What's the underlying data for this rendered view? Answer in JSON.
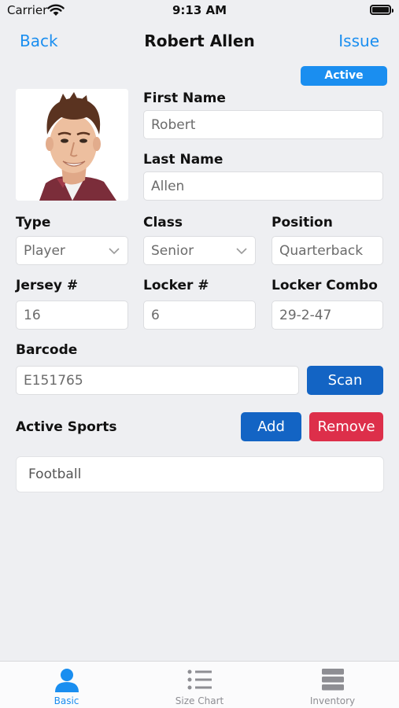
{
  "status_bar": {
    "carrier": "Carrier",
    "time": "9:13 AM"
  },
  "nav": {
    "back_label": "Back",
    "title": "Robert Allen",
    "issue_label": "Issue"
  },
  "status_badge": "Active",
  "form": {
    "first_name_label": "First Name",
    "first_name_value": "Robert",
    "last_name_label": "Last Name",
    "last_name_value": "Allen",
    "type_label": "Type",
    "type_value": "Player",
    "class_label": "Class",
    "class_value": "Senior",
    "position_label": "Position",
    "position_value": "Quarterback",
    "jersey_label": "Jersey #",
    "jersey_value": "16",
    "locker_label": "Locker #",
    "locker_value": "6",
    "combo_label": "Locker Combo",
    "combo_value": "29-2-47",
    "barcode_label": "Barcode",
    "barcode_value": "E151765",
    "scan_label": "Scan"
  },
  "sports": {
    "label": "Active Sports",
    "add_label": "Add",
    "remove_label": "Remove",
    "items": [
      "Football"
    ]
  },
  "tabs": [
    {
      "label": "Basic",
      "icon": "person-icon",
      "active": true
    },
    {
      "label": "Size Chart",
      "icon": "list-icon",
      "active": false
    },
    {
      "label": "Inventory",
      "icon": "stack-icon",
      "active": false
    }
  ],
  "colors": {
    "accent": "#1a8ef0",
    "button_blue": "#1364c4",
    "button_red": "#dd2f4a",
    "background": "#eeeff2",
    "tab_inactive": "#8e8e93"
  }
}
